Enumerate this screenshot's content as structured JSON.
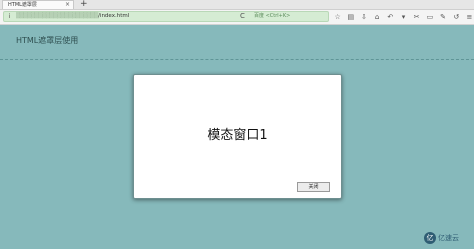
{
  "browser": {
    "tab_title": "HTML遮罩层",
    "tab_close": "×",
    "new_tab": "+",
    "url_prefix": "i",
    "url_host_obscured": "▒▒▒▒▒▒▒▒▒▒▒▒▒▒▒▒▒▒▒▒▒▒",
    "url_path": "/index.html",
    "reload": "C",
    "search_placeholder": "百度 <Ctrl+K>",
    "toolbar_icons": [
      "star-icon",
      "clipboard-icon",
      "download-icon",
      "home-icon",
      "back-icon",
      "dropdown-icon",
      "screenshot-icon",
      "chat-icon",
      "tools-icon",
      "undo-icon",
      "menu-icon"
    ]
  },
  "page": {
    "title": "HTML遮罩层使用"
  },
  "modal": {
    "title": "模态窗口1",
    "close_label": "关闭"
  },
  "watermark": {
    "icon_text": "亿",
    "text": "亿速云"
  }
}
